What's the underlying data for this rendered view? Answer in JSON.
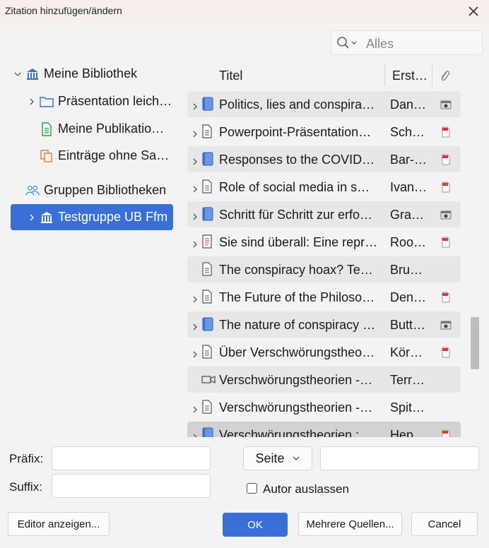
{
  "window": {
    "title": "Zitation hinzufügen/ändern"
  },
  "search": {
    "placeholder": "Alles"
  },
  "tree": [
    {
      "label": "Meine Bibliothek",
      "icon": "library-icon"
    },
    {
      "label": "Präsentation leich…",
      "icon": "folder-icon"
    },
    {
      "label": "Meine Publikatio…",
      "icon": "document-icon"
    },
    {
      "label": "Einträge ohne Sa…",
      "icon": "unfiled-icon"
    },
    {
      "label": "Gruppen Bibliotheken",
      "icon": "group-icon"
    },
    {
      "label": "Testgruppe UB Ffm",
      "icon": "library-icon"
    }
  ],
  "table": {
    "col_title": "Titel",
    "col_creator": "Erst…",
    "rows": [
      {
        "title": "Politics, lies and conspira…",
        "creator": "Dan…",
        "type": "book",
        "attachment": "snapshot"
      },
      {
        "title": "Powerpoint-Präsentation…",
        "creator": "Sch…",
        "type": "document",
        "attachment": "pdf"
      },
      {
        "title": "Responses to the COVID-…",
        "creator": "Bar-…",
        "type": "book",
        "attachment": "pdf"
      },
      {
        "title": "Role of social media in s…",
        "creator": "Ivan…",
        "type": "document",
        "attachment": "pdf"
      },
      {
        "title": "Schritt für Schritt zur erfo…",
        "creator": "Gra…",
        "type": "book",
        "attachment": "snapshot"
      },
      {
        "title": "Sie sind überall: Eine repr…",
        "creator": "Roo…",
        "type": "report",
        "attachment": "pdf"
      },
      {
        "title": "The conspiracy hoax? Tes…",
        "creator": "Bru…",
        "type": "document",
        "attachment": ""
      },
      {
        "title": "The Future of the Philoso…",
        "creator": "Den…",
        "type": "document",
        "attachment": "pdf"
      },
      {
        "title": "The nature of conspiracy …",
        "creator": "Butt…",
        "type": "book",
        "attachment": "snapshot"
      },
      {
        "title": "Über Verschwörungstheo…",
        "creator": "Kör…",
        "type": "document",
        "attachment": "pdf"
      },
      {
        "title": "Verschwörungstheorien -…",
        "creator": "Terr…",
        "type": "video",
        "attachment": ""
      },
      {
        "title": "Verschwörungstheorien -…",
        "creator": "Spit…",
        "type": "document",
        "attachment": ""
      },
      {
        "title": "Verschwörungstheorien :",
        "creator": "Hep…",
        "type": "book",
        "attachment": "pdf"
      }
    ]
  },
  "form": {
    "prefix_label": "Präfix:",
    "suffix_label": "Suffix:",
    "prefix_value": "",
    "suffix_value": "",
    "locator_label": "Seite",
    "locator_value": "",
    "omit_author_label": "Autor auslassen"
  },
  "buttons": {
    "editor": "Editor anzeigen...",
    "ok": "OK",
    "multiple": "Mehrere Quellen...",
    "cancel": "Cancel"
  },
  "colors": {
    "accent": "#3a6fd6",
    "pdf": "#e0303a",
    "book": "#3b6fd0"
  }
}
